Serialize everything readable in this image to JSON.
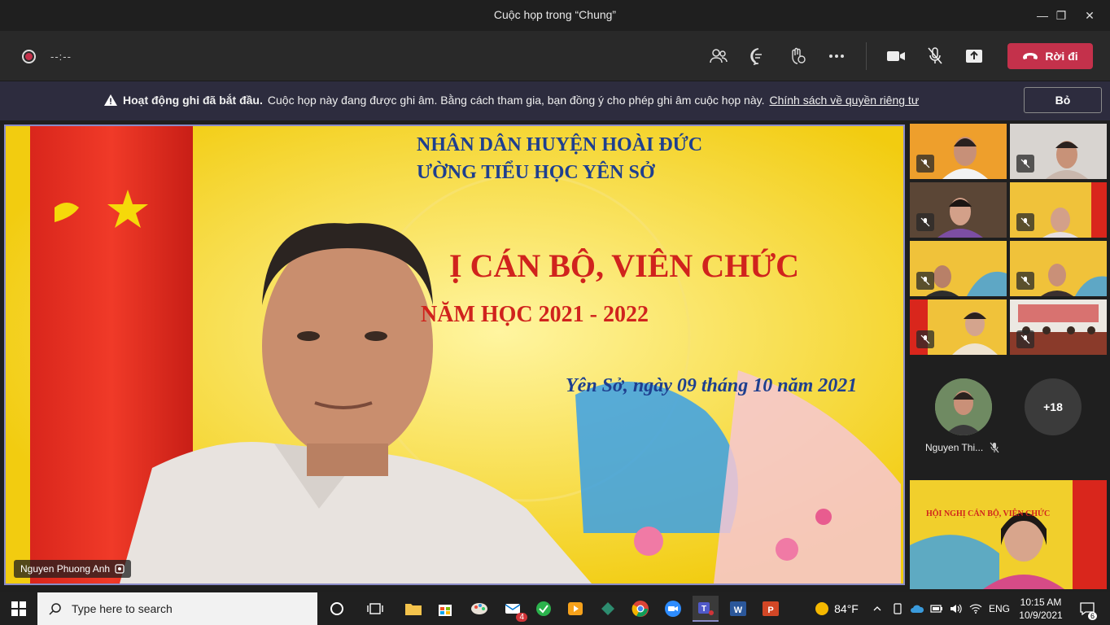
{
  "window": {
    "title": "Cuộc họp trong “Chung”",
    "minimize": "—",
    "maximize": "❐",
    "close": "✕"
  },
  "toolbar": {
    "timer": "--:--",
    "leave_label": "Rời đi"
  },
  "banner": {
    "bold": "Hoạt động ghi đã bắt đầu.",
    "text": "Cuộc họp này đang được ghi âm. Bằng cách tham gia, bạn đồng ý cho phép ghi âm cuộc họp này.",
    "link": "Chính sách về quyền riêng tư",
    "dismiss": "Bỏ"
  },
  "main_video": {
    "participant_name": "Nguyen Phuong Anh",
    "backdrop": {
      "line1": "NHÂN DÂN HUYỆN HOÀI ĐỨC",
      "line2": "ƯỜNG TIỂU HỌC YÊN SỞ",
      "heading": "Ị CÁN BỘ, VIÊN CHỨC",
      "year": "NĂM HỌC 2021 - 2022",
      "date": "Yên Sở, ngày 09 tháng 10 năm 2021"
    }
  },
  "self_view": {
    "heading": "HỘI NGHỊ CÁN BỘ, VIÊN CHỨC"
  },
  "tiles": [
    {
      "id": "1",
      "muted": true
    },
    {
      "id": "2",
      "muted": true
    },
    {
      "id": "3",
      "muted": true
    },
    {
      "id": "4",
      "muted": true
    },
    {
      "id": "5",
      "muted": true
    },
    {
      "id": "6",
      "muted": true
    },
    {
      "id": "7",
      "muted": true
    },
    {
      "id": "8",
      "muted": true
    }
  ],
  "overflow": {
    "avatar_name": "Nguyen Thi...",
    "more_count": "+18"
  },
  "taskbar": {
    "search_placeholder": "Type here to search",
    "mail_badge": "4",
    "weather": "84°F",
    "language": "ENG",
    "time": "10:15 AM",
    "date": "10/9/2021",
    "notifications": "6"
  },
  "colors": {
    "leave": "#c4314b",
    "banner": "#2d2c3e",
    "active_border": "#8b8cc7"
  }
}
